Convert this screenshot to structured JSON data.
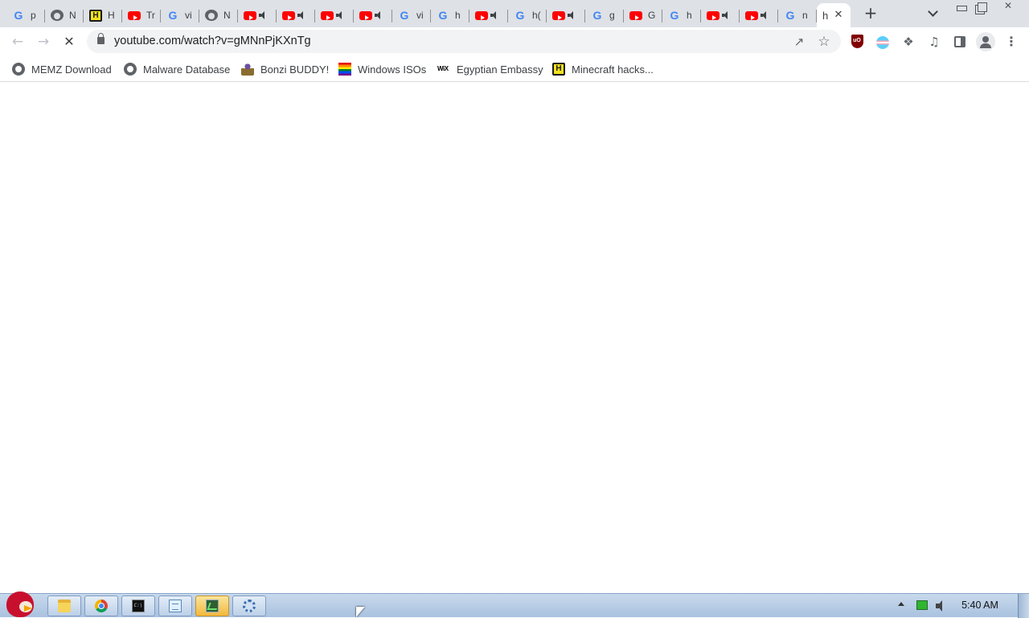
{
  "browser": {
    "tabs": [
      {
        "icon": "google",
        "title": "p",
        "audio": false
      },
      {
        "icon": "globe",
        "title": "N",
        "audio": false
      },
      {
        "icon": "h-logo",
        "title": "H",
        "audio": false
      },
      {
        "icon": "youtube",
        "title": "Tr",
        "audio": false
      },
      {
        "icon": "google",
        "title": "vi",
        "audio": false
      },
      {
        "icon": "globe",
        "title": "N",
        "audio": false
      },
      {
        "icon": "youtube",
        "title": "",
        "audio": true
      },
      {
        "icon": "youtube",
        "title": "",
        "audio": true
      },
      {
        "icon": "youtube",
        "title": "",
        "audio": true
      },
      {
        "icon": "youtube",
        "title": "",
        "audio": true
      },
      {
        "icon": "google",
        "title": "vi",
        "audio": false
      },
      {
        "icon": "google",
        "title": "h",
        "audio": false
      },
      {
        "icon": "youtube",
        "title": "",
        "audio": true
      },
      {
        "icon": "google",
        "title": "h(",
        "audio": false
      },
      {
        "icon": "youtube",
        "title": "",
        "audio": true
      },
      {
        "icon": "google",
        "title": "g",
        "audio": false
      },
      {
        "icon": "youtube",
        "title": "G",
        "audio": false
      },
      {
        "icon": "google",
        "title": "h",
        "audio": false
      },
      {
        "icon": "youtube",
        "title": "",
        "audio": true
      },
      {
        "icon": "youtube",
        "title": "",
        "audio": true
      },
      {
        "icon": "google",
        "title": "n",
        "audio": false
      }
    ],
    "active_tab": {
      "title": "h",
      "close_glyph": "✕"
    },
    "new_tab_glyph": "+",
    "address_bar": {
      "url": "youtube.com/watch?v=gMNnPjKXnTg"
    },
    "nav": {
      "back_glyph": "←",
      "forward_glyph": "→",
      "stop_glyph": "✕"
    },
    "toolbar_icons": [
      "share-icon",
      "star-icon",
      "ublock-icon",
      "trans-flag-extension-icon",
      "extensions-puzzle-icon",
      "media-control-icon",
      "side-panel-icon",
      "profile-icon",
      "menu-icon"
    ],
    "ublock_text": "uO",
    "menu_glyph": "⋮",
    "bookmarks": [
      {
        "label": "MEMZ Download",
        "icon": "globe"
      },
      {
        "label": "Malware Database",
        "icon": "globe"
      },
      {
        "label": "Bonzi BUDDY!",
        "icon": "bonzi"
      },
      {
        "label": "Windows ISOs",
        "icon": "rainbow-flag"
      },
      {
        "label": "Egyptian Embassy",
        "icon": "wix"
      },
      {
        "label": "Minecraft hacks...",
        "icon": "h-logo"
      }
    ],
    "wix_text": "WiX",
    "h_text": "H"
  },
  "taskbar": {
    "apps": [
      "file-explorer",
      "chrome",
      "command-prompt",
      "notepad",
      "task-manager",
      "settings"
    ],
    "active_app": "task-manager",
    "cmd_text": "C:\\",
    "clock": "5:40 AM"
  }
}
